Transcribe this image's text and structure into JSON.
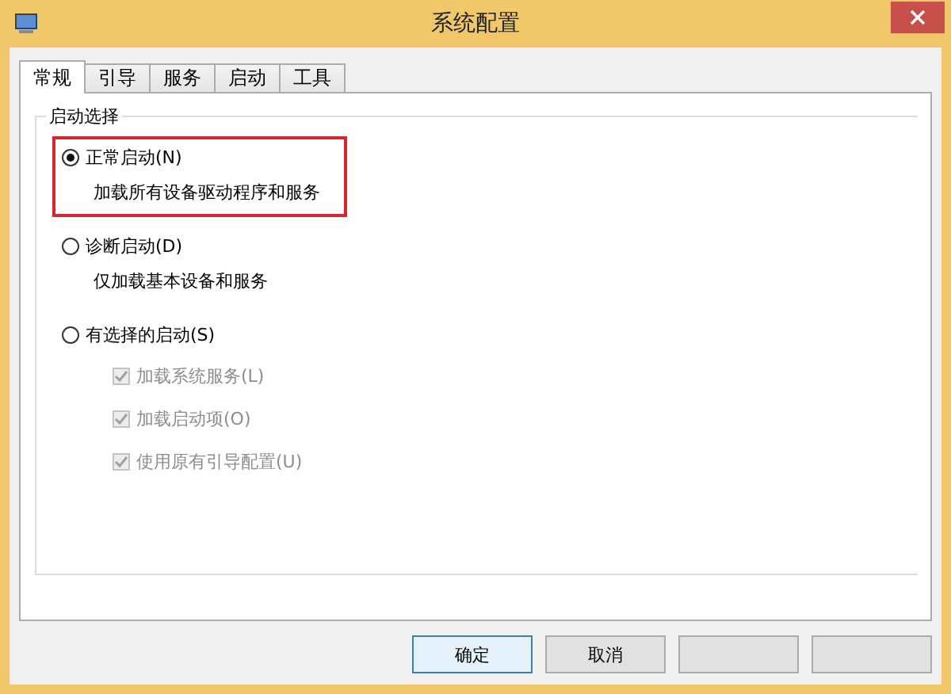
{
  "window": {
    "title": "系统配置"
  },
  "tabs": [
    {
      "label": "常规",
      "selected": true
    },
    {
      "label": "引导",
      "selected": false
    },
    {
      "label": "服务",
      "selected": false
    },
    {
      "label": "启动",
      "selected": false
    },
    {
      "label": "工具",
      "selected": false
    }
  ],
  "group": {
    "title": "启动选择"
  },
  "options": [
    {
      "label": "正常启动(N)",
      "description": "加载所有设备驱动程序和服务",
      "selected": true,
      "highlighted": true
    },
    {
      "label": "诊断启动(D)",
      "description": "仅加载基本设备和服务",
      "selected": false,
      "highlighted": false
    },
    {
      "label": "有选择的启动(S)",
      "selected": false,
      "highlighted": false
    }
  ],
  "sub_options": [
    {
      "label": "加载系统服务(L)",
      "checked": true,
      "disabled": true
    },
    {
      "label": "加载启动项(O)",
      "checked": true,
      "disabled": true
    },
    {
      "label": "使用原有引导配置(U)",
      "checked": true,
      "disabled": true
    }
  ],
  "buttons": [
    {
      "kind": "labeled",
      "label": "确定",
      "default": true
    },
    {
      "kind": "labeled",
      "label": "取消",
      "default": false
    },
    {
      "kind": "blank",
      "default": false
    },
    {
      "kind": "blank",
      "default": false
    }
  ]
}
